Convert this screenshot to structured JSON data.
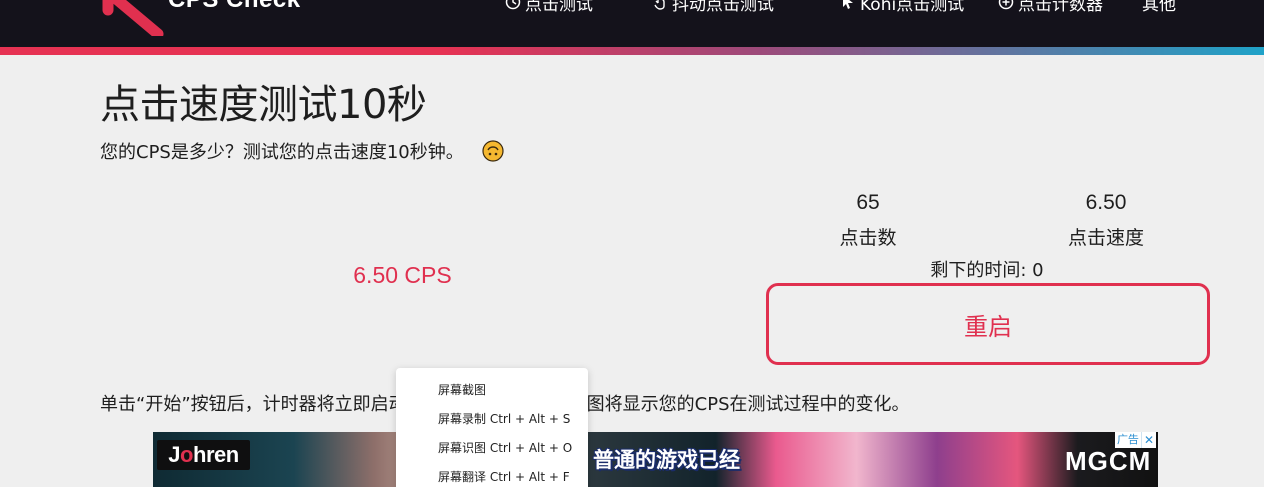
{
  "header": {
    "logo_text": "CPS Check",
    "nav": [
      {
        "label": "点击测试",
        "icon": "clock-icon"
      },
      {
        "label": "抖动点击测试",
        "icon": "hand-pointer-icon"
      },
      {
        "label": "Kohi点击测试",
        "icon": "cursor-icon"
      },
      {
        "label": "点击计数器",
        "icon": "plus-circle-icon"
      },
      {
        "label": "其他",
        "icon": ""
      }
    ]
  },
  "main": {
    "title": "点击速度测试10秒",
    "subtitle": "您的CPS是多少？测试您的点击速度10秒钟。",
    "cps_result": "6.50 CPS",
    "stats": {
      "clicks_value": "65",
      "clicks_label": "点击数",
      "speed_value": "6.50",
      "speed_label": "点击速度"
    },
    "time_left": "剩下的时间: 0",
    "restart_label": "重启",
    "instructions": "单击“开始”按钮后，计时器将立即启动，您可以快速单击。下图将显示您的CPS在测试过程中的变化。"
  },
  "ad": {
    "brand_prefix": "J",
    "brand_o": "o",
    "brand_suffix": "hren",
    "headline": "普通的游戏已经",
    "logo": "MGCM",
    "badge_label": "广告",
    "badge_close": "✕"
  },
  "context_menu": {
    "items": [
      "屏幕截图",
      "屏幕录制 Ctrl + Alt + S",
      "屏幕识图 Ctrl + Alt + O",
      "屏幕翻译 Ctrl + Alt + F"
    ]
  },
  "colors": {
    "accent": "#e0304f",
    "header_bg": "#14121b",
    "page_bg": "#efefef"
  }
}
